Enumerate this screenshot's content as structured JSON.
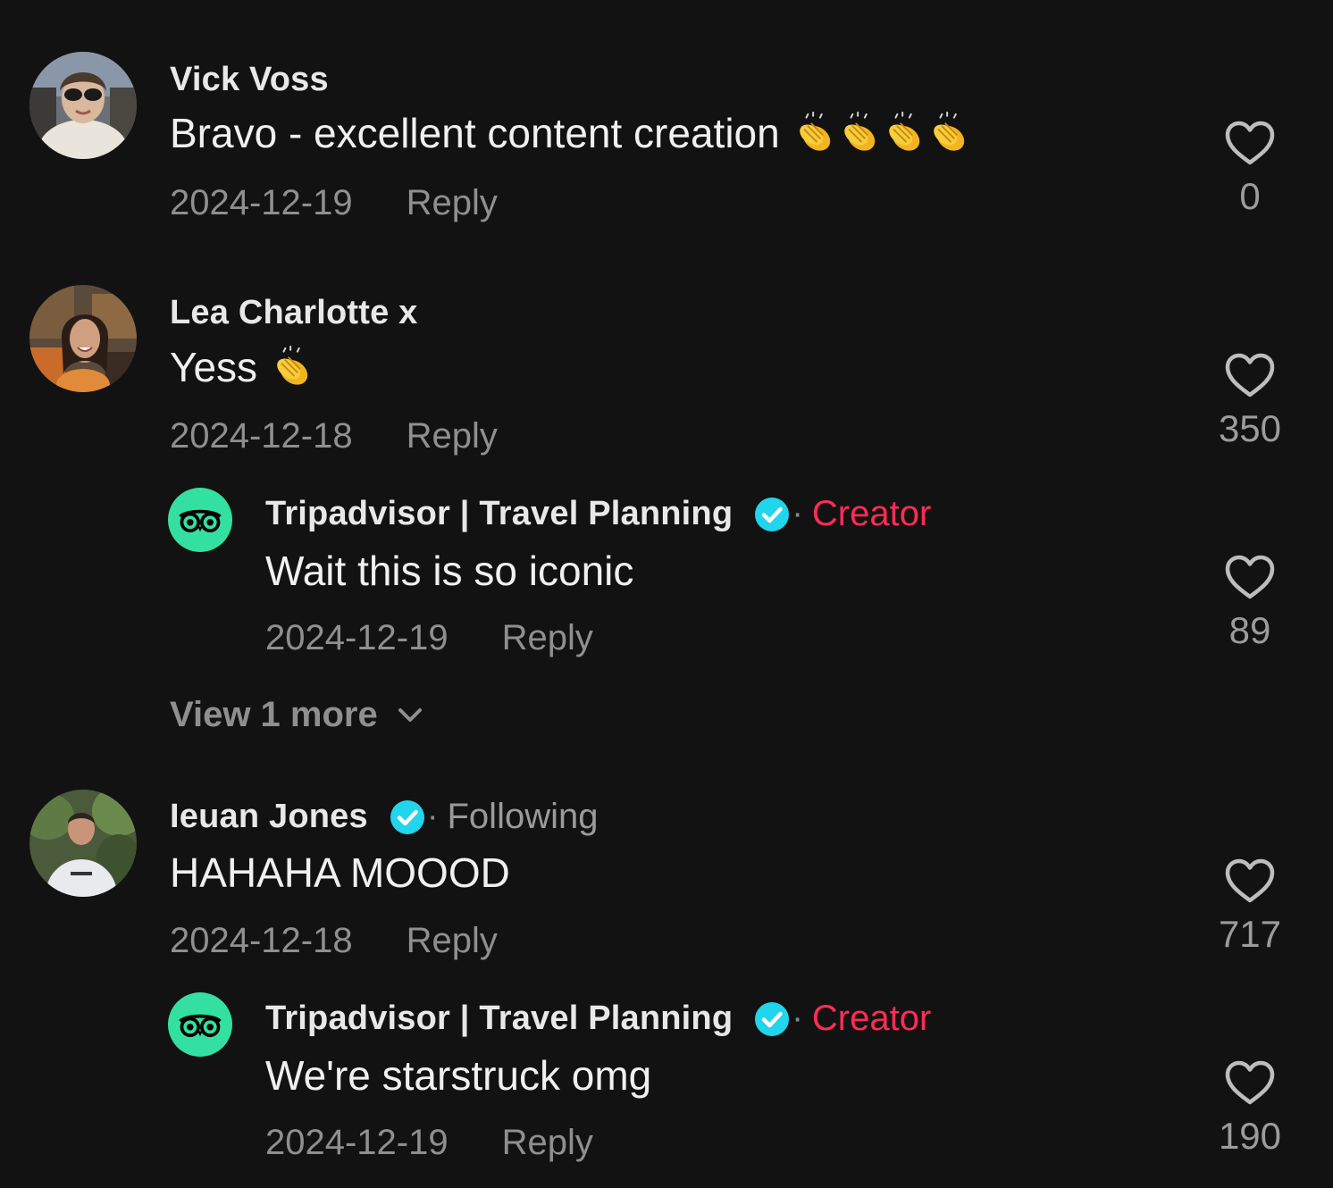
{
  "colors": {
    "background": "#121212",
    "creator": "#fe2c55",
    "verified": "#20d5ec",
    "tripadvisor": "#34e0a1",
    "muted": "#8f8f8f"
  },
  "comments": [
    {
      "username": "Vick Voss",
      "text": "Bravo - excellent content creation",
      "emoji": "clapping-hands x4",
      "date": "2024-12-19",
      "reply_label": "Reply",
      "likes": "0"
    },
    {
      "username": "Lea Charlotte x",
      "text": "Yess",
      "emoji": "clapping-hands x1",
      "date": "2024-12-18",
      "reply_label": "Reply",
      "likes": "350",
      "replies": [
        {
          "username": "Tripadvisor | Travel Planning",
          "verified": true,
          "tag": "Creator",
          "text": "Wait this is so iconic",
          "date": "2024-12-19",
          "reply_label": "Reply",
          "likes": "89"
        }
      ],
      "view_more": "View 1 more"
    },
    {
      "username": "Ieuan Jones",
      "verified": true,
      "tag": "Following",
      "text": "HAHAHA MOOOD",
      "date": "2024-12-18",
      "reply_label": "Reply",
      "likes": "717",
      "replies": [
        {
          "username": "Tripadvisor | Travel Planning",
          "verified": true,
          "tag": "Creator",
          "text": "We're starstruck omg",
          "date": "2024-12-19",
          "reply_label": "Reply",
          "likes": "190"
        }
      ]
    }
  ]
}
